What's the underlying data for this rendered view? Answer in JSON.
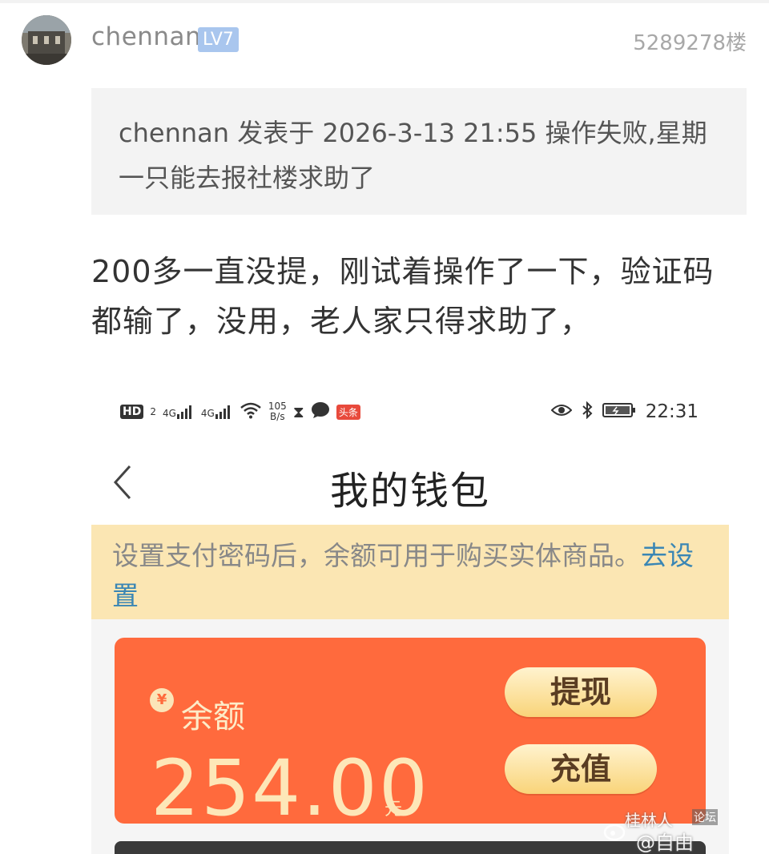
{
  "post": {
    "username": "chennan",
    "level": "LV7",
    "floor": "5289278楼"
  },
  "quote": {
    "text": "chennan 发表于 2026-3-13 21:55 操作失败,星期一只能去报社楼求助了"
  },
  "reply": {
    "text": "200多一直没提，刚试着操作了一下，验证码都输了，没用，老人家只得求助了，"
  },
  "phone": {
    "statusbar": {
      "hd": "HD",
      "hd_sub": "2",
      "signal1": "4G",
      "signal2": "4G",
      "net_speed_value": "105",
      "net_speed_unit": "B/s",
      "toutiao": "头条",
      "time": "22:31"
    },
    "nav": {
      "back_icon": "chevron-left-icon",
      "title": "我的钱包"
    },
    "notice": {
      "text": "设置支付密码后，余额可用于购买实体商品。",
      "link": "去设置"
    },
    "wallet": {
      "currency_symbol": "¥",
      "balance_label": "余额",
      "balance_amount": "254.00",
      "balance_unit": "元",
      "withdraw_label": "提现",
      "recharge_label": "充值",
      "card_color": "#ff6a3d"
    }
  },
  "watermark": {
    "line1": "桂林人",
    "badge": "论坛",
    "line2": "@自由"
  },
  "colors": {
    "level_badge": "#a9c6ee",
    "notice_bg": "#fbe6b3",
    "notice_link": "#3a86b4",
    "button_gold": "#f9d479"
  }
}
